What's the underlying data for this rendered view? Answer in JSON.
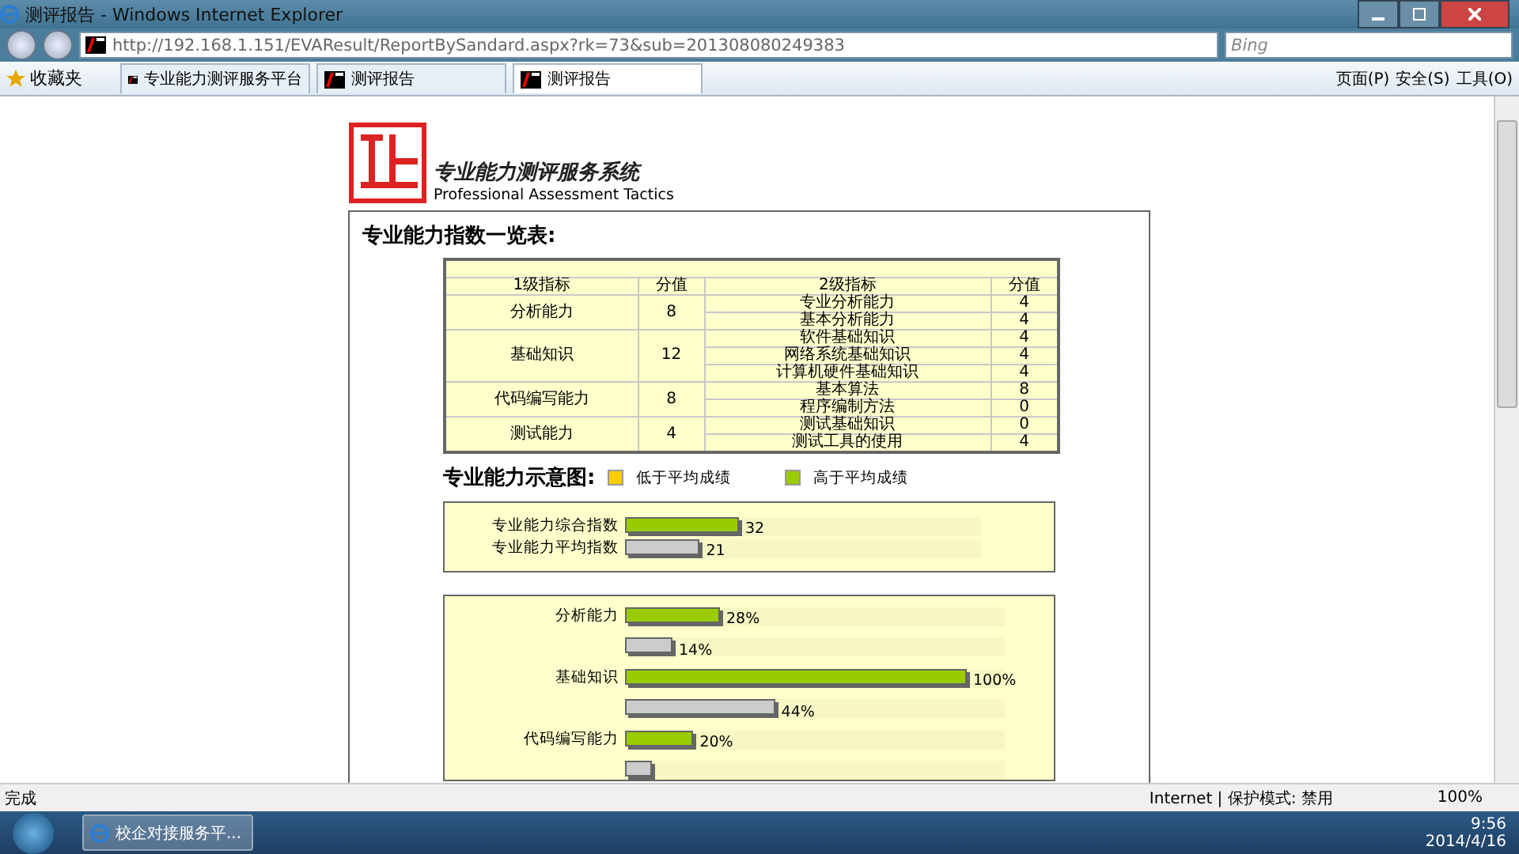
{
  "window": {
    "title": "测评报告 - Windows Internet Explorer"
  },
  "address_bar": {
    "url": "http://192.168.1.151/EVAResult/ReportBySandard.aspx?rk=73&sub=201308080249383"
  },
  "search": {
    "placeholder": "Bing"
  },
  "favorites": {
    "label": "收藏夹"
  },
  "tabs": [
    {
      "label": "专业能力测评服务平台",
      "selected": false
    },
    {
      "label": "测评报告",
      "selected": false
    },
    {
      "label": "测评报告",
      "selected": true
    }
  ],
  "command_menus": [
    "页面(P)",
    "安全(S)",
    "工具(O)"
  ],
  "page": {
    "brand_title": "专业能力测评服务系统",
    "brand_subtitle": "Professional Assessment Tactics",
    "table_heading": "专业能力指数一览表:",
    "columns": [
      "1级指标",
      "分值",
      "2级指标",
      "分值"
    ],
    "groups": [
      {
        "name": "分析能力",
        "score": "8",
        "items": [
          {
            "name": "专业分析能力",
            "score": "4"
          },
          {
            "name": "基本分析能力",
            "score": "4"
          }
        ]
      },
      {
        "name": "基础知识",
        "score": "12",
        "items": [
          {
            "name": "软件基础知识",
            "score": "4"
          },
          {
            "name": "网络系统基础知识",
            "score": "4"
          },
          {
            "name": "计算机硬件基础知识",
            "score": "4"
          }
        ]
      },
      {
        "name": "代码编写能力",
        "score": "8",
        "items": [
          {
            "name": "基本算法",
            "score": "8"
          },
          {
            "name": "程序编制方法",
            "score": "0"
          }
        ]
      },
      {
        "name": "测试能力",
        "score": "4",
        "items": [
          {
            "name": "测试基础知识",
            "score": "0"
          },
          {
            "name": "测试工具的使用",
            "score": "4"
          }
        ]
      }
    ],
    "chart_heading": "专业能力示意图:",
    "legend": [
      {
        "label": "低于平均成绩",
        "color": "#ffcc00"
      },
      {
        "label": "高于平均成绩",
        "color": "#99cc00"
      }
    ],
    "summary_bars": [
      {
        "label": "专业能力综合指数",
        "reading": "32",
        "level": 0.32,
        "color": "#99cc00"
      },
      {
        "label": "专业能力平均指数",
        "reading": "21",
        "level": 0.21,
        "color": "#cccccc"
      }
    ],
    "detail_bars": [
      {
        "label": "分析能力",
        "reading": "28%",
        "level": 0.25,
        "color": "#99cc00"
      },
      {
        "reading": "14%",
        "level": 0.125,
        "color": "#cccccc"
      },
      {
        "label": "基础知识",
        "reading": "100%",
        "level": 0.9,
        "color": "#99cc00"
      },
      {
        "reading": "44%",
        "level": 0.395,
        "color": "#cccccc"
      },
      {
        "label": "代码编写能力",
        "reading": "20%",
        "level": 0.18,
        "color": "#99cc00"
      },
      {
        "level": 0.07,
        "color": "#cccccc"
      }
    ]
  },
  "status_bar": {
    "text": "完成",
    "zone": "Internet | 保护模式: 禁用",
    "zoom": "100%"
  },
  "taskbar": {
    "task": "校企对接服务平...",
    "time": "9:56",
    "date": "2014/4/16"
  }
}
